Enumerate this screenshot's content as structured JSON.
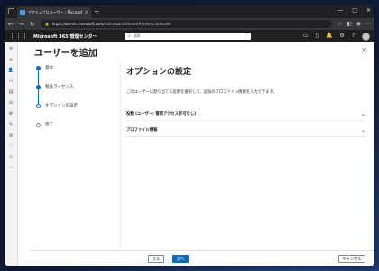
{
  "browser": {
    "tab_title": "アクティブなユーザー - Microsoft 36",
    "tab_close": "×",
    "new_tab": "+",
    "url_host": "https://admin.microsoft.com",
    "url_path": "/Adminportal/Home#/users/:/adduser",
    "window_controls": [
      "—",
      "□",
      "✕"
    ]
  },
  "m365": {
    "app_title": "Microsoft 365 管理センター",
    "search_placeholder": "検索"
  },
  "panel": {
    "title": "ユーザーを追加",
    "close": "×"
  },
  "steps": [
    {
      "label": "基本",
      "state": "done"
    },
    {
      "label": "製品ライセンス",
      "state": "done"
    },
    {
      "label": "オプションの設定",
      "state": "current"
    },
    {
      "label": "完了",
      "state": "todo"
    }
  ],
  "main": {
    "heading": "オプションの設定",
    "description": "このユーザーに割り当てる役割を選択して、追加のプロファイル情報を入力できます。",
    "accordions": [
      {
        "label": "役割 (ユーザー: 管理アクセス許可なし)"
      },
      {
        "label": "プロファイル情報"
      }
    ]
  },
  "footer": {
    "back": "戻る",
    "next": "次へ",
    "cancel": "キャンセル"
  },
  "colors": {
    "accent": "#0f6cbd",
    "header_bg": "#1f1f1f"
  }
}
